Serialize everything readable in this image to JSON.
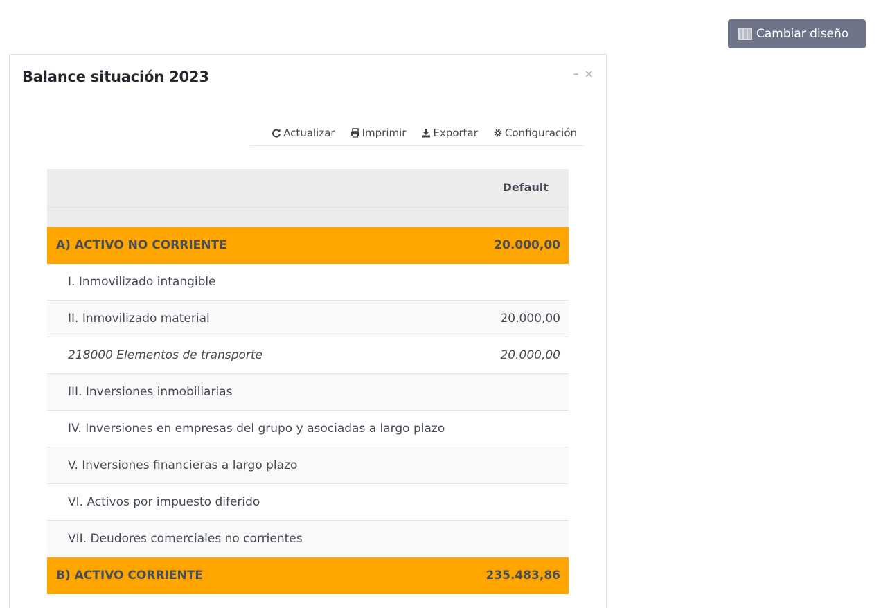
{
  "header": {
    "layout_button_label": "Cambiar diseño"
  },
  "panel": {
    "title": "Balance situación 2023",
    "minimize_symbol": "–",
    "close_symbol": "×"
  },
  "toolbar": {
    "refresh_label": "Actualizar",
    "print_label": "Imprimir",
    "export_label": "Exportar",
    "config_label": "Configuración"
  },
  "table": {
    "column_header": "Default",
    "rows": [
      {
        "label": "A) ACTIVO NO CORRIENTE",
        "value": "20.000,00",
        "type": "group"
      },
      {
        "label": "I. Inmovilizado intangible",
        "value": "",
        "type": "item"
      },
      {
        "label": "II. Inmovilizado material",
        "value": "20.000,00",
        "type": "item"
      },
      {
        "label": "218000 Elementos de transporte",
        "value": "20.000,00",
        "type": "account"
      },
      {
        "label": "III. Inversiones inmobiliarias",
        "value": "",
        "type": "item"
      },
      {
        "label": "IV. Inversiones en empresas del grupo y asociadas a largo plazo",
        "value": "",
        "type": "item"
      },
      {
        "label": "V. Inversiones financieras a largo plazo",
        "value": "",
        "type": "item"
      },
      {
        "label": "VI. Activos por impuesto diferido",
        "value": "",
        "type": "item"
      },
      {
        "label": "VII. Deudores comerciales no corrientes",
        "value": "",
        "type": "item"
      },
      {
        "label": "B) ACTIVO CORRIENTE",
        "value": "235.483,86",
        "type": "group"
      }
    ]
  },
  "colors": {
    "group_row": "#ffa500",
    "layout_button": "#6f7489",
    "header_row": "#ececec"
  },
  "icons": {
    "layout": "columns-icon",
    "refresh": "refresh-icon",
    "print": "print-icon",
    "export": "download-icon",
    "config": "gear-icon"
  }
}
